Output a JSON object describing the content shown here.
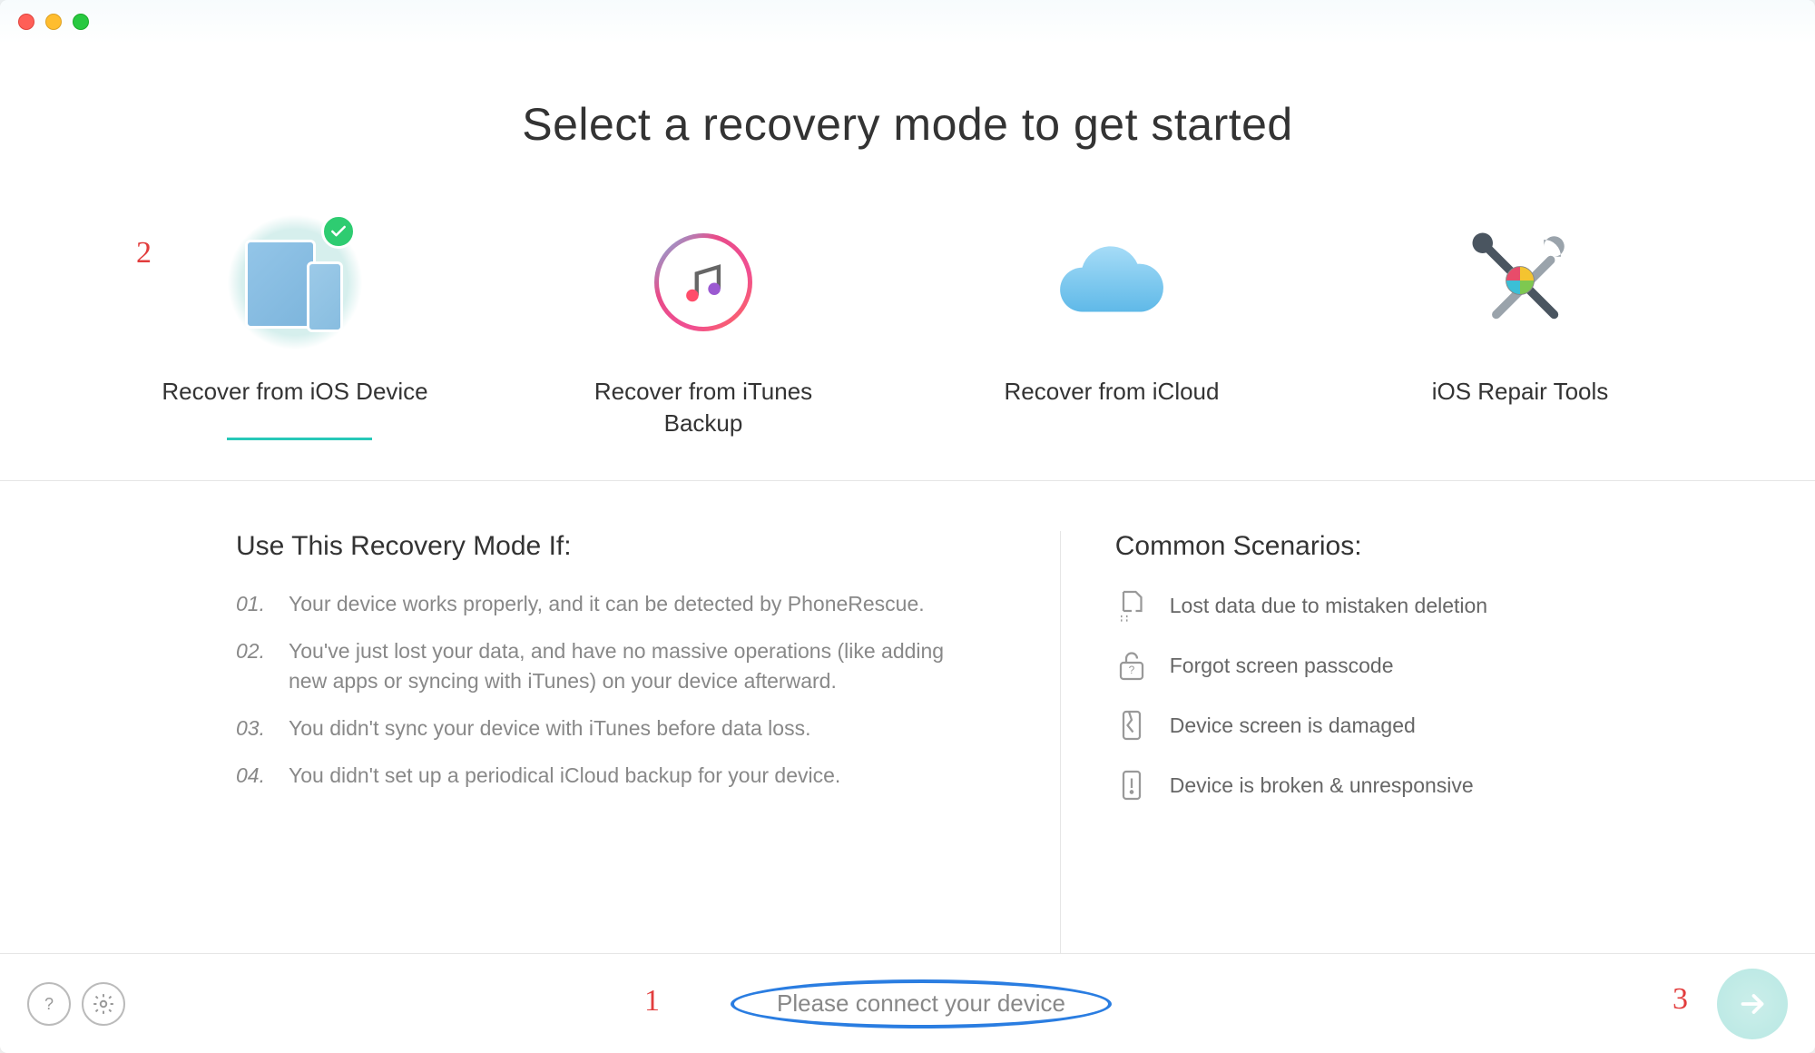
{
  "header": {
    "title": "Select a recovery mode to get started"
  },
  "modes": [
    {
      "label": "Recover from iOS Device",
      "selected": true
    },
    {
      "label": "Recover from iTunes Backup",
      "selected": false
    },
    {
      "label": "Recover from iCloud",
      "selected": false
    },
    {
      "label": "iOS Repair Tools",
      "selected": false
    }
  ],
  "details": {
    "left_title": "Use This Recovery Mode If:",
    "conditions": [
      {
        "num": "01.",
        "text": "Your device works properly, and it can be detected by PhoneRescue."
      },
      {
        "num": "02.",
        "text": "You've just lost your data, and have no massive operations (like adding new apps or syncing with iTunes) on your device afterward."
      },
      {
        "num": "03.",
        "text": "You didn't sync your device with iTunes before data loss."
      },
      {
        "num": "04.",
        "text": "You didn't set up a periodical iCloud backup for your device."
      }
    ],
    "right_title": "Common Scenarios:",
    "scenarios": [
      "Lost data due to mistaken deletion",
      "Forgot screen passcode",
      "Device screen is damaged",
      "Device is broken & unresponsive"
    ]
  },
  "footer": {
    "status": "Please connect your device"
  },
  "annotations": {
    "a1": "1",
    "a2": "2",
    "a3": "3"
  }
}
